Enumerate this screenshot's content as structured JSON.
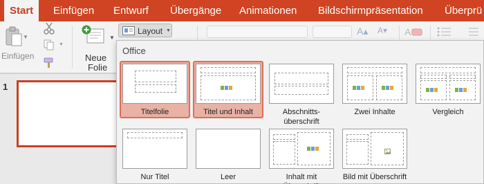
{
  "ribbon": {
    "tabs": [
      {
        "label": "Start",
        "active": true
      },
      {
        "label": "Einfügen"
      },
      {
        "label": "Entwurf"
      },
      {
        "label": "Übergänge"
      },
      {
        "label": "Animationen"
      },
      {
        "label": "Bildschirmpräsentation"
      },
      {
        "label": "Überprü"
      }
    ],
    "paste_label": "Einfügen",
    "new_slide_label_1": "Neue",
    "new_slide_label_2": "Folie",
    "layout_button_label": "Layout",
    "accent_color": "#d04423"
  },
  "slides_pane": {
    "slide_number": "1"
  },
  "layout_gallery": {
    "group_title": "Office",
    "layouts": [
      {
        "name": "Titelfolie",
        "selected": true
      },
      {
        "name": "Titel und Inhalt",
        "selected": true
      },
      {
        "name": "Abschnitts-\nüberschrift"
      },
      {
        "name": "Zwei Inhalte"
      },
      {
        "name": "Vergleich"
      },
      {
        "name": "Nur Titel"
      },
      {
        "name": "Leer"
      },
      {
        "name": "Inhalt mit Überschrift"
      },
      {
        "name": "Bild mit Überschrift"
      }
    ],
    "selection_color": "#e8b2a5"
  }
}
